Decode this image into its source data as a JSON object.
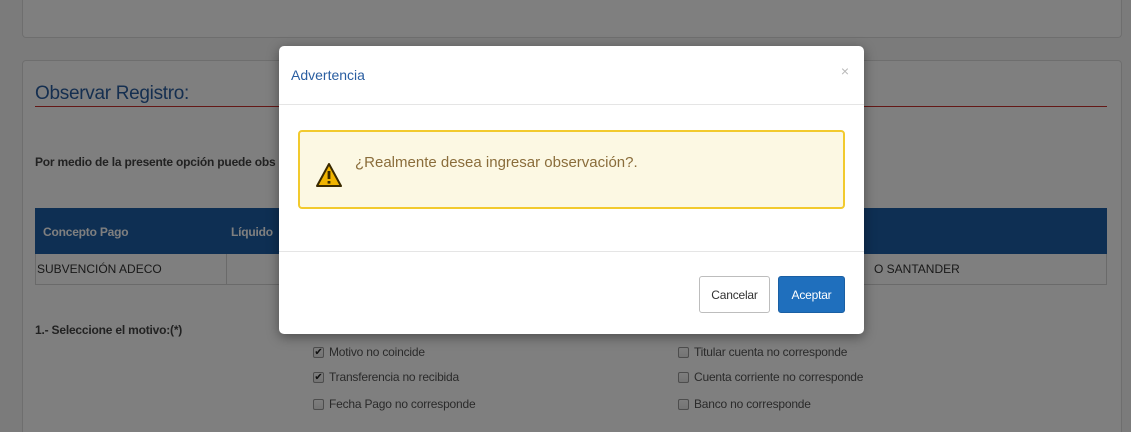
{
  "section": {
    "title": "Observar Registro:",
    "description": "Por medio de la presente opción puede obs"
  },
  "table": {
    "headers": [
      "Concepto Pago",
      "Líquido"
    ],
    "row": [
      "SUBVENCIÓN ADECO",
      "O SANTANDER"
    ]
  },
  "motivo": {
    "label": "1.- Seleccione el motivo:(*)",
    "options_left": [
      {
        "label": "Motivo no coincide",
        "checked": true
      },
      {
        "label": "Transferencia no recibida",
        "checked": true
      },
      {
        "label": "Fecha Pago no corresponde",
        "checked": false
      }
    ],
    "options_right": [
      {
        "label": "Titular cuenta no corresponde",
        "checked": false
      },
      {
        "label": "Cuenta corriente no corresponde",
        "checked": false
      },
      {
        "label": "Banco no corresponde",
        "checked": false
      }
    ]
  },
  "modal": {
    "title": "Advertencia",
    "close": "×",
    "message": "¿Realmente desea ingresar observación?.",
    "cancel_label": "Cancelar",
    "accept_label": "Aceptar",
    "icon": "warning-icon"
  },
  "colors": {
    "primary": "#1d5fa6",
    "title": "#2a5ea1",
    "rule": "#c9302c",
    "alert_bg": "#fcf8e3",
    "alert_border": "#f2ca2e",
    "alert_text": "#8a6d3b"
  }
}
